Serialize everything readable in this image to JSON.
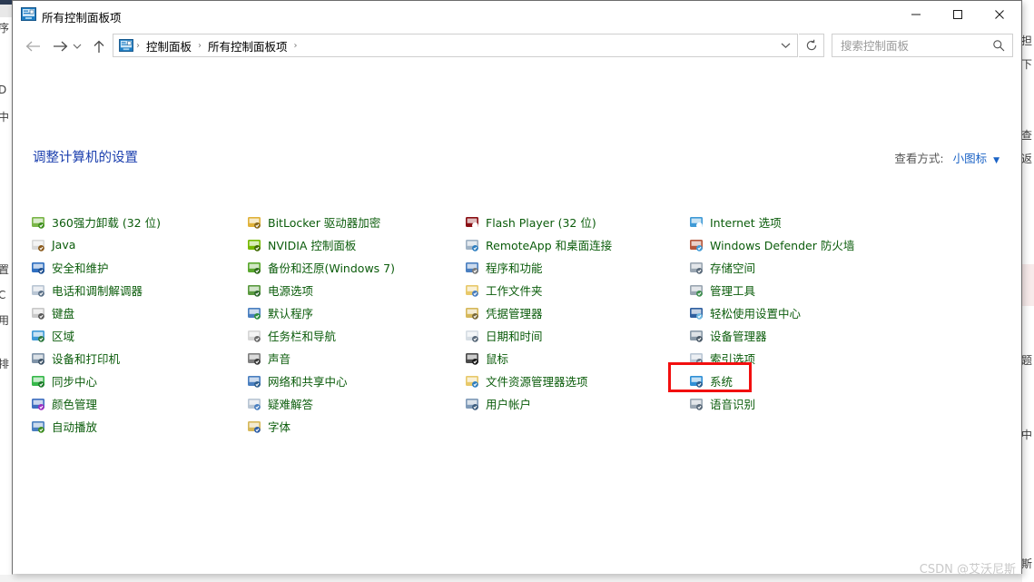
{
  "window": {
    "title": "所有控制面板项",
    "title_icon": "control-panel-icon",
    "controls": {
      "minimize": "最小化",
      "maximize": "最大化",
      "close": "关闭"
    }
  },
  "nav": {
    "back": "后退",
    "forward": "前进",
    "recent": "最近使用的位置",
    "up": "上移一级",
    "address_icon": "control-panel-icon",
    "breadcrumbs": [
      "控制面板",
      "所有控制面板项"
    ],
    "separator": "›",
    "dropdown": "历史位置",
    "refresh": "刷新"
  },
  "search": {
    "placeholder": "搜索控制面板",
    "value": "",
    "icon": "search-icon"
  },
  "content": {
    "heading": "调整计算机的设置",
    "view_by": {
      "label": "查看方式:",
      "value": "小图标",
      "caret": "▼"
    }
  },
  "highlight": {
    "target": "系统",
    "color": "#f20f0f"
  },
  "watermark": "CSDN @艾沃尼斯",
  "colors": {
    "heading": "#1b3fae",
    "item_label": "#0b5c0b",
    "link": "#1b63c6",
    "highlight": "#f20f0f"
  },
  "columns": [
    {
      "items": [
        {
          "label": "360强力卸载 (32 位)",
          "icon": "uninstall-360-icon",
          "c1": "#7ab648",
          "c2": "#3f8f1f"
        },
        {
          "label": "Java",
          "icon": "java-icon",
          "c1": "#d8d8d8",
          "c2": "#8a5a1c"
        },
        {
          "label": "安全和维护",
          "icon": "flag-security-icon",
          "c1": "#2f6fc0",
          "c2": "#1d4e8f"
        },
        {
          "label": "电话和调制解调器",
          "icon": "modem-icon",
          "c1": "#b9c6d4",
          "c2": "#5d7288"
        },
        {
          "label": "键盘",
          "icon": "keyboard-icon",
          "c1": "#c9c9c9",
          "c2": "#5a5a5a"
        },
        {
          "label": "区域",
          "icon": "region-globe-icon",
          "c1": "#3f9ad6",
          "c2": "#2f7a3f"
        },
        {
          "label": "设备和打印机",
          "icon": "devices-printers-icon",
          "c1": "#7f93a8",
          "c2": "#3f5468"
        },
        {
          "label": "同步中心",
          "icon": "sync-center-icon",
          "c1": "#36b84a",
          "c2": "#1d7a2a"
        },
        {
          "label": "颜色管理",
          "icon": "color-management-icon",
          "c1": "#3f6fc0",
          "c2": "#9b2fc0"
        },
        {
          "label": "自动播放",
          "icon": "autoplay-icon",
          "c1": "#4a7fc0",
          "c2": "#3f8f1f"
        }
      ]
    },
    {
      "items": [
        {
          "label": "BitLocker 驱动器加密",
          "icon": "bitlocker-icon",
          "c1": "#e0b23a",
          "c2": "#8a6a1c"
        },
        {
          "label": "NVIDIA 控制面板",
          "icon": "nvidia-icon",
          "c1": "#76b900",
          "c2": "#3f6a00"
        },
        {
          "label": "备份和还原(Windows 7)",
          "icon": "backup-restore-icon",
          "c1": "#5aa82f",
          "c2": "#2f6a1c"
        },
        {
          "label": "电源选项",
          "icon": "power-options-icon",
          "c1": "#5a9a3f",
          "c2": "#2f6a2f"
        },
        {
          "label": "默认程序",
          "icon": "default-programs-icon",
          "c1": "#4a7fc0",
          "c2": "#2f8f3f"
        },
        {
          "label": "任务栏和导航",
          "icon": "taskbar-navigation-icon",
          "c1": "#d6d6d6",
          "c2": "#6a6a6a"
        },
        {
          "label": "声音",
          "icon": "sound-icon",
          "c1": "#7f7f7f",
          "c2": "#3a3a3a"
        },
        {
          "label": "网络和共享中心",
          "icon": "network-sharing-icon",
          "c1": "#4a7fc0",
          "c2": "#2f5f8f"
        },
        {
          "label": "疑难解答",
          "icon": "troubleshooting-icon",
          "c1": "#b9c6d4",
          "c2": "#4a7fc0"
        },
        {
          "label": "字体",
          "icon": "fonts-icon",
          "c1": "#d6b85a",
          "c2": "#2f5fa8"
        }
      ]
    },
    {
      "items": [
        {
          "label": "Flash Player (32 位)",
          "icon": "flash-player-icon",
          "c1": "#8a0f14",
          "c2": "#ffffff"
        },
        {
          "label": "RemoteApp 和桌面连接",
          "icon": "remoteapp-icon",
          "c1": "#9fb2c4",
          "c2": "#2f7fc0"
        },
        {
          "label": "程序和功能",
          "icon": "programs-features-icon",
          "c1": "#4a7fc0",
          "c2": "#7a7a7a"
        },
        {
          "label": "工作文件夹",
          "icon": "work-folders-icon",
          "c1": "#e8c96a",
          "c2": "#4a7fc0"
        },
        {
          "label": "凭据管理器",
          "icon": "credential-manager-icon",
          "c1": "#d6b85a",
          "c2": "#7a6a3a"
        },
        {
          "label": "日期和时间",
          "icon": "date-time-icon",
          "c1": "#d6dde4",
          "c2": "#5a6a7a"
        },
        {
          "label": "鼠标",
          "icon": "mouse-icon",
          "c1": "#4a4a4a",
          "c2": "#1a1a1a"
        },
        {
          "label": "文件资源管理器选项",
          "icon": "file-explorer-options-icon",
          "c1": "#e8c96a",
          "c2": "#2f7fc0"
        },
        {
          "label": "用户帐户",
          "icon": "user-accounts-icon",
          "c1": "#7f9ab8",
          "c2": "#3f5f7f"
        }
      ]
    },
    {
      "items": [
        {
          "label": "Internet 选项",
          "icon": "internet-options-icon",
          "c1": "#3f9ad6",
          "c2": "#ffffff"
        },
        {
          "label": "Windows Defender 防火墙",
          "icon": "windows-firewall-icon",
          "c1": "#b5563a",
          "c2": "#3f9ad6"
        },
        {
          "label": "存储空间",
          "icon": "storage-spaces-icon",
          "c1": "#9aa6b2",
          "c2": "#5a6a7a"
        },
        {
          "label": "管理工具",
          "icon": "administrative-tools-icon",
          "c1": "#9aa6b2",
          "c2": "#3f8f4f"
        },
        {
          "label": "轻松使用设置中心",
          "icon": "ease-of-access-icon",
          "c1": "#2f5f9f",
          "c2": "#6fb8e0"
        },
        {
          "label": "设备管理器",
          "icon": "device-manager-icon",
          "c1": "#8a9aa8",
          "c2": "#4a5a68"
        },
        {
          "label": "索引选项",
          "icon": "indexing-options-icon",
          "c1": "#b9c6d4",
          "c2": "#6a7a8a"
        },
        {
          "label": "系统",
          "icon": "system-icon",
          "c1": "#2f8fd6",
          "c2": "#2f5f8f"
        },
        {
          "label": "语音识别",
          "icon": "speech-recognition-icon",
          "c1": "#9aa6b2",
          "c2": "#5a6a7a"
        }
      ]
    }
  ],
  "background_fragments": {
    "left": [
      "序",
      "D",
      "中",
      "置",
      "C",
      "用",
      "排"
    ],
    "right": [
      "担",
      "下",
      "查",
      "返",
      "题",
      "中",
      "斯"
    ]
  }
}
